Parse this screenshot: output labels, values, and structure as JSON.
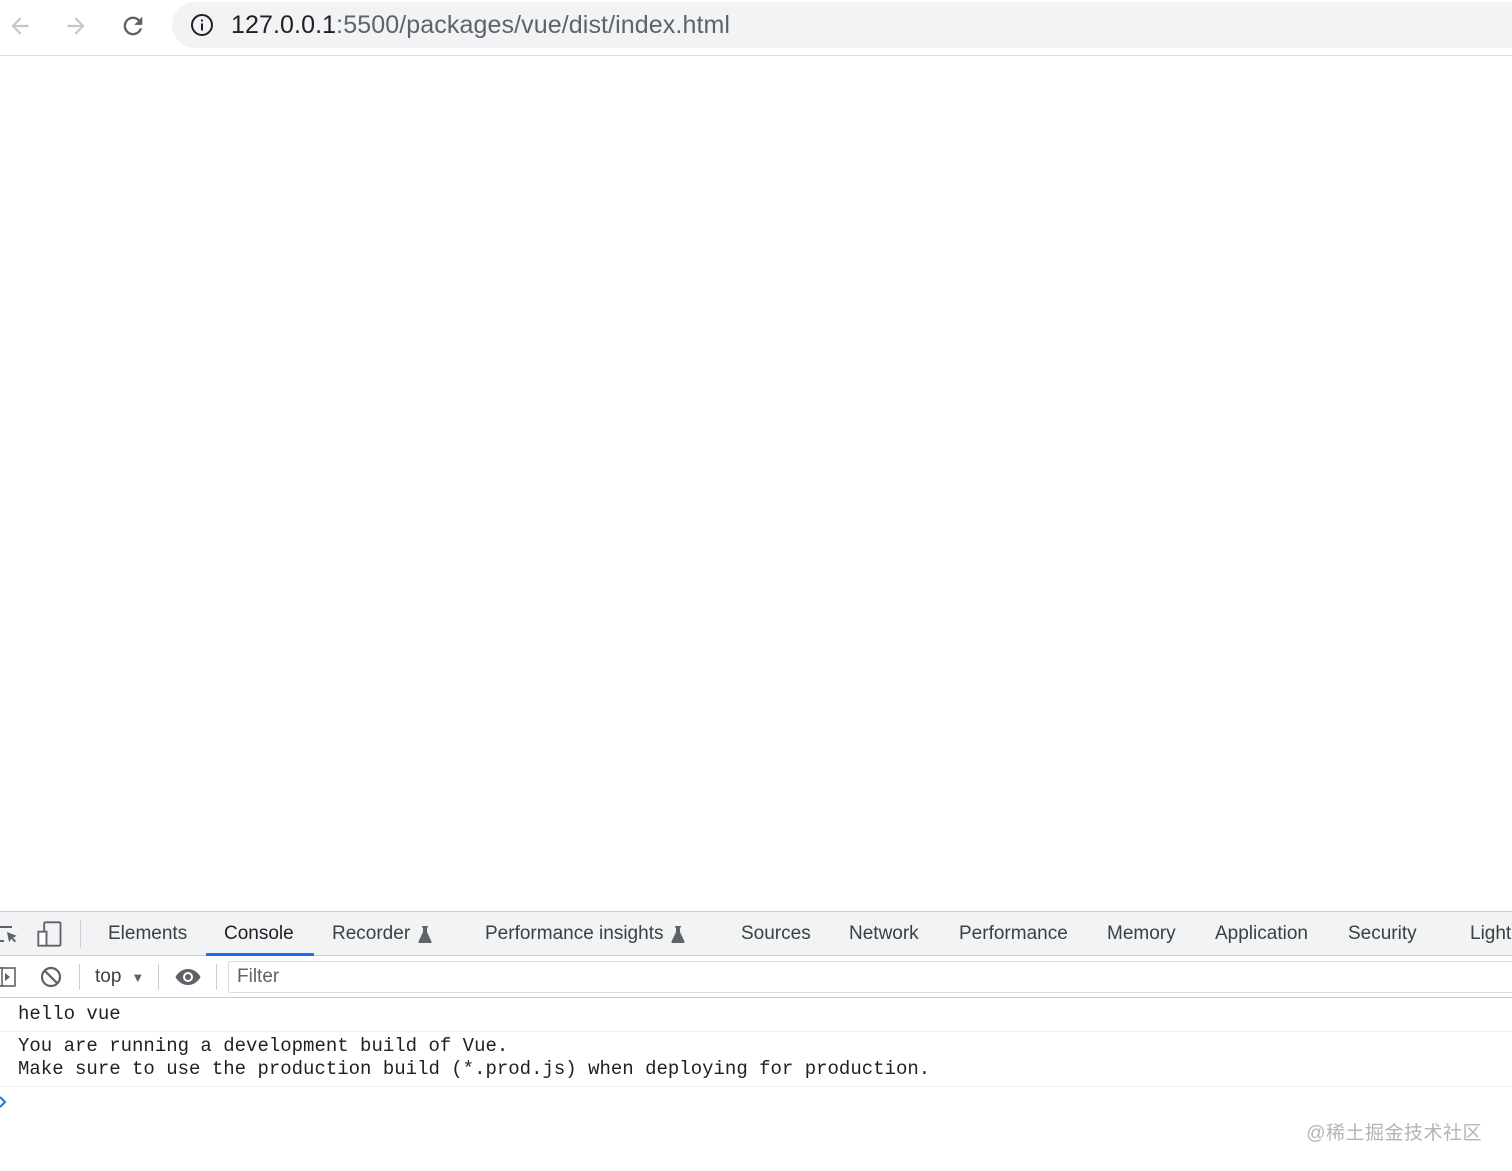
{
  "browser": {
    "url_host": "127.0.0.1",
    "url_path": ":5500/packages/vue/dist/index.html"
  },
  "devtools": {
    "tabs": [
      {
        "label": "Elements"
      },
      {
        "label": "Console"
      },
      {
        "label": "Recorder"
      },
      {
        "label": "Performance insights"
      },
      {
        "label": "Sources"
      },
      {
        "label": "Network"
      },
      {
        "label": "Performance"
      },
      {
        "label": "Memory"
      },
      {
        "label": "Application"
      },
      {
        "label": "Security"
      },
      {
        "label": "Light"
      }
    ],
    "active_tab": "Console",
    "accent_color": "#1a73e8",
    "context_label": "top",
    "filter_placeholder": "Filter"
  },
  "console": {
    "messages": [
      {
        "text": "hello vue"
      },
      {
        "text": "You are running a development build of Vue.\nMake sure to use the production build (*.prod.js) when deploying for production."
      }
    ]
  },
  "watermark": "@稀土掘金技术社区"
}
